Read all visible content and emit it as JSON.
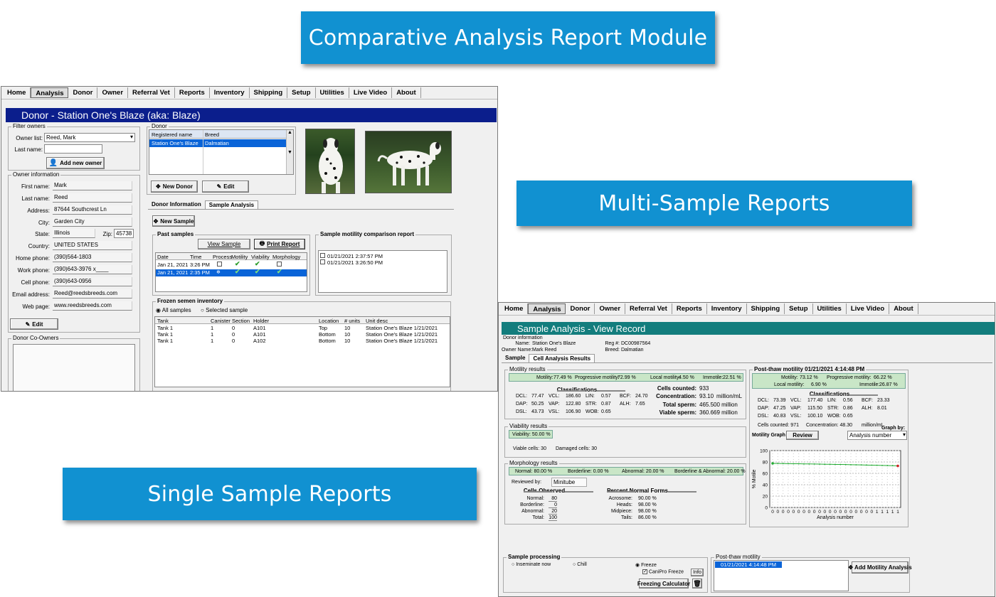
{
  "banners": {
    "comparative": "Comparative Analysis Report Module",
    "multi": "Multi-Sample Reports",
    "single": "Single Sample Reports"
  },
  "colors": {
    "banner": "#1191d1",
    "donor_title": "#0b1e8c",
    "sample_title": "#137d7d",
    "selection": "#0a64d8"
  },
  "menu": [
    "Home",
    "Analysis",
    "Donor",
    "Owner",
    "Referral Vet",
    "Reports",
    "Inventory",
    "Shipping",
    "Setup",
    "Utilities",
    "Live Video",
    "About"
  ],
  "menu_active": "Analysis",
  "donor_window": {
    "title": "Donor - Station One's Blaze (aka: Blaze)",
    "filter": {
      "group": "Filter owners",
      "owner_list_label": "Owner list:",
      "owner_list_value": "Reed, Mark",
      "last_name_label": "Last name:",
      "last_name_value": "",
      "add_owner_button": "Add new owner"
    },
    "owner": {
      "group": "Owner information",
      "fields": [
        {
          "label": "First name:",
          "value": "Mark"
        },
        {
          "label": "Last name:",
          "value": "Reed"
        },
        {
          "label": "Address:",
          "value": "87644 Southcrest Ln"
        },
        {
          "label": "City:",
          "value": "Garden City"
        },
        {
          "label": "State:",
          "value": "Illinois"
        },
        {
          "label": "Country:",
          "value": "UNITED STATES"
        },
        {
          "label": "Home phone:",
          "value": "(390)564-1803"
        },
        {
          "label": "Work phone:",
          "value": "(390)643-3976 x____"
        },
        {
          "label": "Cell phone:",
          "value": "(390)643-0956"
        },
        {
          "label": "Email address:",
          "value": "Reed@reedsbreeds.com"
        },
        {
          "label": "Web page:",
          "value": "www.reedsbreeds.com"
        }
      ],
      "zip_label": "Zip:",
      "zip_value": "45738",
      "edit_button": "Edit"
    },
    "coowners_group": "Donor Co-Owners",
    "donor_group": "Donor",
    "donor_table": {
      "headers": [
        "Registered name",
        "Breed"
      ],
      "rows": [
        [
          "Station One's Blaze",
          "Dalmatian"
        ]
      ]
    },
    "new_donor_button": "New Donor",
    "edit_button": "Edit",
    "tabs": [
      "Donor Information",
      "Sample Analysis"
    ],
    "new_sample_button": "New Sample",
    "past_samples": {
      "group": "Past samples",
      "view_button": "View Sample",
      "print_button": "Print Report",
      "headers": [
        "Date",
        "Time",
        "Process",
        "Motility",
        "Viability",
        "Morphology"
      ],
      "rows": [
        [
          "Jan 21, 2021",
          "3:26 PM"
        ],
        [
          "Jan 21, 2021",
          "2:35 PM"
        ]
      ]
    },
    "motility_comparison": {
      "group": "Sample motility comparison report",
      "items": [
        "01/21/2021 2:37:57 PM",
        "01/21/2021 3:26:50 PM"
      ]
    },
    "frozen": {
      "group": "Frozen semen inventory",
      "radio_all": "All samples",
      "radio_selected": "Selected sample",
      "headers": [
        "Tank",
        "Canister",
        "Section",
        "Holder",
        "Location",
        "# units",
        "Unit desc"
      ],
      "rows": [
        [
          "Tank 1",
          "1",
          "0",
          "A101",
          "Top",
          "10",
          "Station One's Blaze 1/21/2021"
        ],
        [
          "Tank 1",
          "1",
          "0",
          "A101",
          "Bottom",
          "10",
          "Station One's Blaze 1/21/2021"
        ],
        [
          "Tank 1",
          "1",
          "0",
          "A102",
          "Bottom",
          "10",
          "Station One's Blaze 1/21/2021"
        ]
      ]
    }
  },
  "sample_window": {
    "title": "Sample Analysis - View Record",
    "donor_info": {
      "group": "Donor information",
      "name_label": "Name:",
      "name": "Station One's Blaze",
      "owner_label": "Owner Name:",
      "owner": "Mark Reed",
      "reg_label": "Reg #:",
      "reg": "DC00987564",
      "breed_label": "Breed:",
      "breed": "Dalmatian"
    },
    "tabs": [
      "Sample",
      "Cell Analysis Results"
    ],
    "motility": {
      "group": "Motility results",
      "bar": [
        "Motility:",
        "77.49 %",
        "Progressive motility:",
        "72.99 %",
        "Local motility:",
        "4.50 %",
        "Immotile:",
        "22.51 %"
      ],
      "classifications": "Classifications",
      "cells": [
        [
          "DCL:",
          "77.47",
          "VCL:",
          "186.60",
          "LIN:",
          "0.57",
          "BCF:",
          "24.70"
        ],
        [
          "DAP:",
          "50.25",
          "VAP:",
          "122.80",
          "STR:",
          "0.87",
          "ALH:",
          "7.65"
        ],
        [
          "DSL:",
          "43.73",
          "VSL:",
          "106.90",
          "WOB:",
          "0.65",
          "",
          ""
        ]
      ],
      "cells_counted_label": "Cells counted:",
      "cells_counted": "933",
      "concentration_label": "Concentration:",
      "concentration": "93.10",
      "concentration_unit": "million/mL",
      "total_sperm_label": "Total sperm:",
      "total_sperm": "465.500 million",
      "viable_sperm_label": "Viable sperm:",
      "viable_sperm": "360.669 million"
    },
    "viability": {
      "group": "Viability results",
      "bar": "Viability: 50.00 %",
      "viable_cells": "Viable cells: 30",
      "damaged_cells": "Damaged cells: 30"
    },
    "morphology": {
      "group": "Morphology results",
      "bar": [
        "Normal: 80.00 %",
        "Borderline: 0.00 %",
        "Abnormal: 20.00 %",
        "Borderline & Abnormal: 20.00 %"
      ],
      "reviewed_label": "Reviewed by:",
      "reviewed_value": "Minitube",
      "cells_observed": "Cells Observed",
      "observed": [
        [
          "Normal:",
          "80"
        ],
        [
          "Borderline:",
          "0"
        ],
        [
          "Abnormal:",
          "20"
        ],
        [
          "Total:",
          "100"
        ]
      ],
      "percent_normal": "Percent Normal Forms",
      "forms": [
        [
          "Acrosome:",
          "90.00 %"
        ],
        [
          "Heads:",
          "98.00 %"
        ],
        [
          "Midpiece:",
          "98.00 %"
        ],
        [
          "Tails:",
          "86.00 %"
        ]
      ]
    },
    "post_thaw": {
      "title": "Post-thaw motility 01/21/2021 4:14:48 PM",
      "bar1": [
        "Motility:",
        "73.12 %",
        "Progressive motility:",
        "66.22 %"
      ],
      "bar2": [
        "Local motility:",
        "6.90 %",
        "Immotile:",
        "26.87 %"
      ],
      "classifications": "Classifications",
      "cells": [
        [
          "DCL:",
          "73.39",
          "VCL:",
          "177.40",
          "LIN:",
          "0.56",
          "BCF:",
          "23.33"
        ],
        [
          "DAP:",
          "47.25",
          "VAP:",
          "115.50",
          "STR:",
          "0.86",
          "ALH:",
          "8.01"
        ],
        [
          "DSL:",
          "40.83",
          "VSL:",
          "100.10",
          "WOB:",
          "0.65",
          "",
          ""
        ]
      ],
      "cells_counted": "Cells counted: 971",
      "concentration": "Concentration: 48.30",
      "concentration_unit": "million/mL",
      "graph_by_label": "Graph by:",
      "graph_by_value": "Analysis number",
      "graph_label": "Motility Graph",
      "review_button": "Review"
    },
    "processing": {
      "group": "Sample processing",
      "inseminate": "Inseminate now",
      "chill": "Chill",
      "freeze": "Freeze",
      "canipro": "CaniPro Freeze",
      "info_button": "Info",
      "calc_button": "Freezing Calculator"
    },
    "post_thaw_list": {
      "group": "Post-thaw motility",
      "items": [
        "01/21/2021 4:14:48 PM"
      ],
      "add_button": "Add Motility Analysis"
    }
  },
  "chart_data": {
    "type": "line",
    "title": "",
    "xlabel": "Analysis number",
    "ylabel": "% Motile",
    "x_tick_labels": [
      "0",
      "0",
      "0",
      "0",
      "0",
      "0",
      "0",
      "0",
      "0",
      "0",
      "0",
      "0",
      "0",
      "0",
      "0",
      "0",
      "0",
      "0",
      "0",
      "0",
      "1",
      "1",
      "1",
      "1",
      "1"
    ],
    "ylim": [
      0,
      100
    ],
    "yticks": [
      0,
      20,
      40,
      60,
      80,
      100
    ],
    "grid": true,
    "series": [
      {
        "color": "#22aa33",
        "values": [
          77.5,
          77.3,
          77.2,
          77.0,
          76.9,
          76.8,
          76.6,
          76.5,
          76.4,
          76.2,
          76.0,
          75.9,
          75.7,
          75.6,
          75.4,
          75.2,
          75.0,
          74.8,
          74.6,
          74.4,
          74.2,
          73.9,
          73.7,
          73.4,
          73.1
        ]
      }
    ]
  }
}
